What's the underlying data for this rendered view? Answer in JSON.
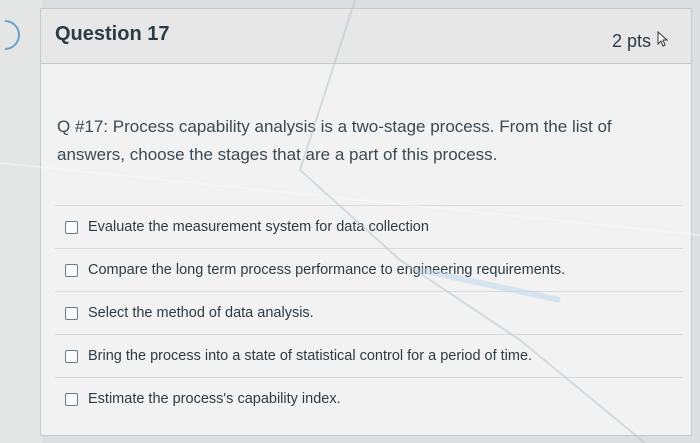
{
  "question": {
    "title": "Question 17",
    "points": "2 pts",
    "text": "Q #17: Process capability analysis is a two-stage process. From the list of answers, choose the stages that are a part of this process."
  },
  "answers": [
    {
      "label": "Evaluate the measurement system for data collection"
    },
    {
      "label": "Compare the long term process performance to engineering requirements."
    },
    {
      "label": "Select the method of data analysis."
    },
    {
      "label": "Bring the process into a state of statistical control for a period of time."
    },
    {
      "label": "Estimate the process's capability index."
    }
  ],
  "icons": {
    "cursor": "mouse-pointer-icon",
    "nav": "previous-arrow-icon"
  },
  "colors": {
    "text": "#2d3b45",
    "header_bg": "#e6e7e6",
    "card_bg": "#f1f2f1"
  }
}
